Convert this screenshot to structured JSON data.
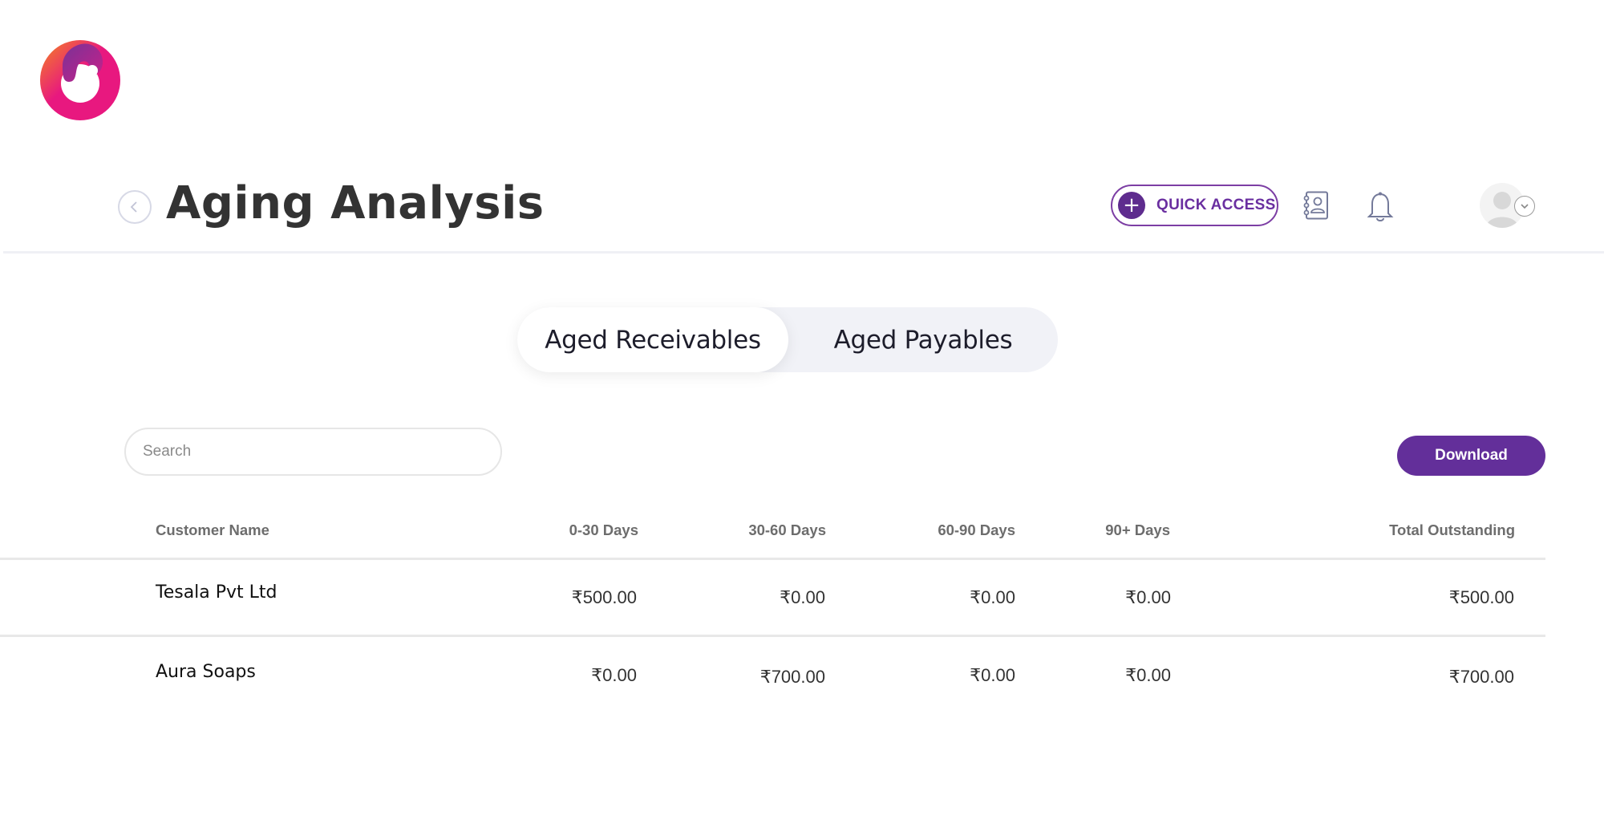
{
  "header": {
    "title": "Aging Analysis",
    "quick_access_label": "QUICK ACCESS"
  },
  "tabs": [
    {
      "label": "Aged Receivables",
      "active": true
    },
    {
      "label": "Aged Payables",
      "active": false
    }
  ],
  "search": {
    "placeholder": "Search",
    "value": ""
  },
  "toolbar": {
    "download_label": "Download"
  },
  "table": {
    "columns": [
      "Customer Name",
      "0-30 Days",
      "30-60 Days",
      "60-90 Days",
      "90+ Days",
      "Total Outstanding"
    ],
    "rows": [
      {
        "name": "Tesala Pvt Ltd",
        "d0_30": "₹500.00",
        "d30_60": "₹0.00",
        "d60_90": "₹0.00",
        "d90": "₹0.00",
        "total": "₹500.00"
      },
      {
        "name": "Aura Soaps",
        "d0_30": "₹0.00",
        "d30_60": "₹700.00",
        "d60_90": "₹0.00",
        "d90": "₹0.00",
        "total": "₹700.00"
      }
    ]
  },
  "colors": {
    "brand_purple": "#632f9a",
    "logo_pink": "#e8187f",
    "logo_orange": "#f5861f"
  }
}
